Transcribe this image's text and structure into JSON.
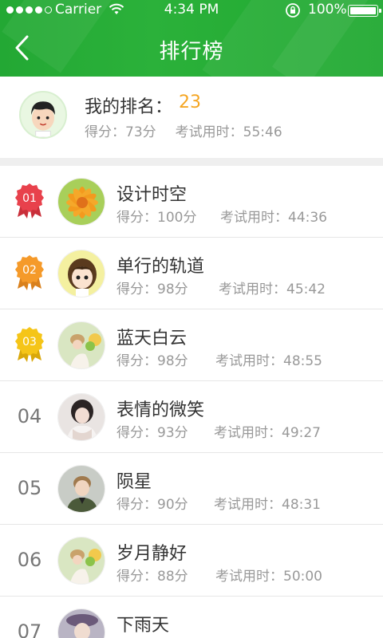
{
  "status_bar": {
    "carrier": "Carrier",
    "time": "4:34 PM",
    "battery": "100%",
    "signal_dots_filled": 4,
    "signal_dots_total": 5
  },
  "nav": {
    "title": "排行榜",
    "back_icon": "chevron-left-icon"
  },
  "colors": {
    "header_green": "#23a834",
    "rank_orange": "#f5a623",
    "badge_red": "#e8414c",
    "badge_orange": "#f59a2a",
    "badge_yellow": "#f5c518"
  },
  "my_rank": {
    "label": "我的排名：",
    "rank": "23",
    "score": "得分：73分",
    "duration": "考试用时：55:46"
  },
  "leaderboard": [
    {
      "rank": "01",
      "name": "设计时空",
      "score": "得分：100分",
      "duration": "考试用时：44:36"
    },
    {
      "rank": "02",
      "name": "单行的轨道",
      "score": "得分：98分",
      "duration": "考试用时：45:42"
    },
    {
      "rank": "03",
      "name": "蓝天白云",
      "score": "得分：98分",
      "duration": "考试用时：48:55"
    },
    {
      "rank": "04",
      "name": "表情的微笑",
      "score": "得分：93分",
      "duration": "考试用时：49:27"
    },
    {
      "rank": "05",
      "name": "陨星",
      "score": "得分：90分",
      "duration": "考试用时：48:31"
    },
    {
      "rank": "06",
      "name": "岁月静好",
      "score": "得分：88分",
      "duration": "考试用时：50:00"
    },
    {
      "rank": "07",
      "name": "下雨天",
      "score": "",
      "duration": ""
    }
  ]
}
